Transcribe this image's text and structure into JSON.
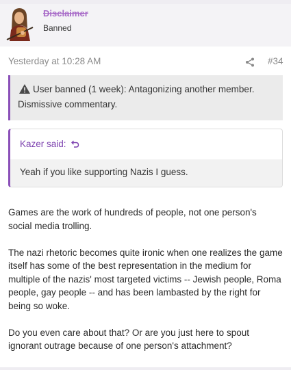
{
  "user": {
    "name": "Disclaimer",
    "title": "Banned"
  },
  "post": {
    "date": "Yesterday at 10:28 AM",
    "number": "#34",
    "share_icon": "share-icon"
  },
  "ban_notice": {
    "icon": "warning-icon",
    "text": "User banned (1 week): Antagonizing another member. Dismissive commentary."
  },
  "quote": {
    "author": "Kazer said:",
    "icon": "jump-to-quote-icon",
    "text": "Yeah if you like supporting Nazis I guess."
  },
  "message": {
    "paragraphs": [
      "Games are the work of hundreds of people, not one person's social media trolling.",
      "The nazi rhetoric becomes quite ironic when one realizes the game itself has some of the best representation in the medium for multiple of the nazis' most targeted victims -- Jewish people, Roma people, gay people -- and has been lambasted by the right for being so woke.",
      "Do you even care about that? Or are you just here to spout ignorant outrage because of one person's attachment?"
    ]
  },
  "colors": {
    "accent": "#8a4fb8",
    "username": "#a86bc8",
    "meta": "#8a8a8a"
  }
}
